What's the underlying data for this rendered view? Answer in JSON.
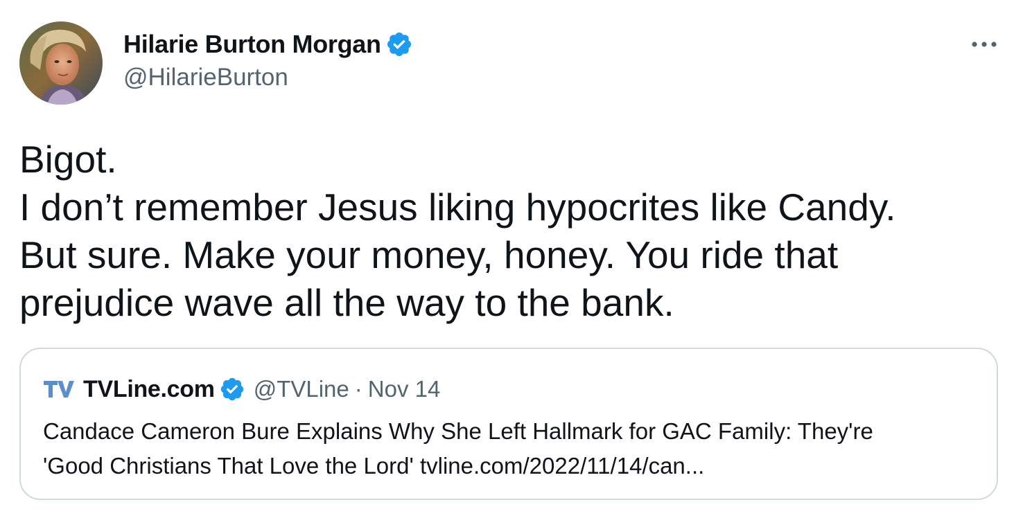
{
  "author": {
    "name": "Hilarie Burton Morgan",
    "handle": "@HilarieBurton",
    "verified": true,
    "avatar_icon": "avatar-photo"
  },
  "menu": {
    "more_icon": "more-horizontal-icon",
    "more_label": "···"
  },
  "tweet": {
    "lines": [
      "Bigot.",
      "I don’t remember Jesus liking hypocrites like Candy.",
      "But sure. Make your money, honey. You ride that",
      "prejudice wave all the way to the bank."
    ]
  },
  "quoted_tweet": {
    "logo_icon": "tvline-logo",
    "name": "TVLine.com",
    "verified": true,
    "handle": "@TVLine",
    "separator": "·",
    "date": "Nov 14",
    "lines": [
      "Candace Cameron Bure Explains Why She Left Hallmark for GAC Family: They're",
      "'Good Christians That Love the Lord' tvline.com/2022/11/14/can..."
    ]
  },
  "colors": {
    "text": "#0f1419",
    "secondary": "#536471",
    "border": "#cfd9de",
    "verified_blue": "#1d9bf0",
    "tvline_blue": "#5b8fc9"
  }
}
